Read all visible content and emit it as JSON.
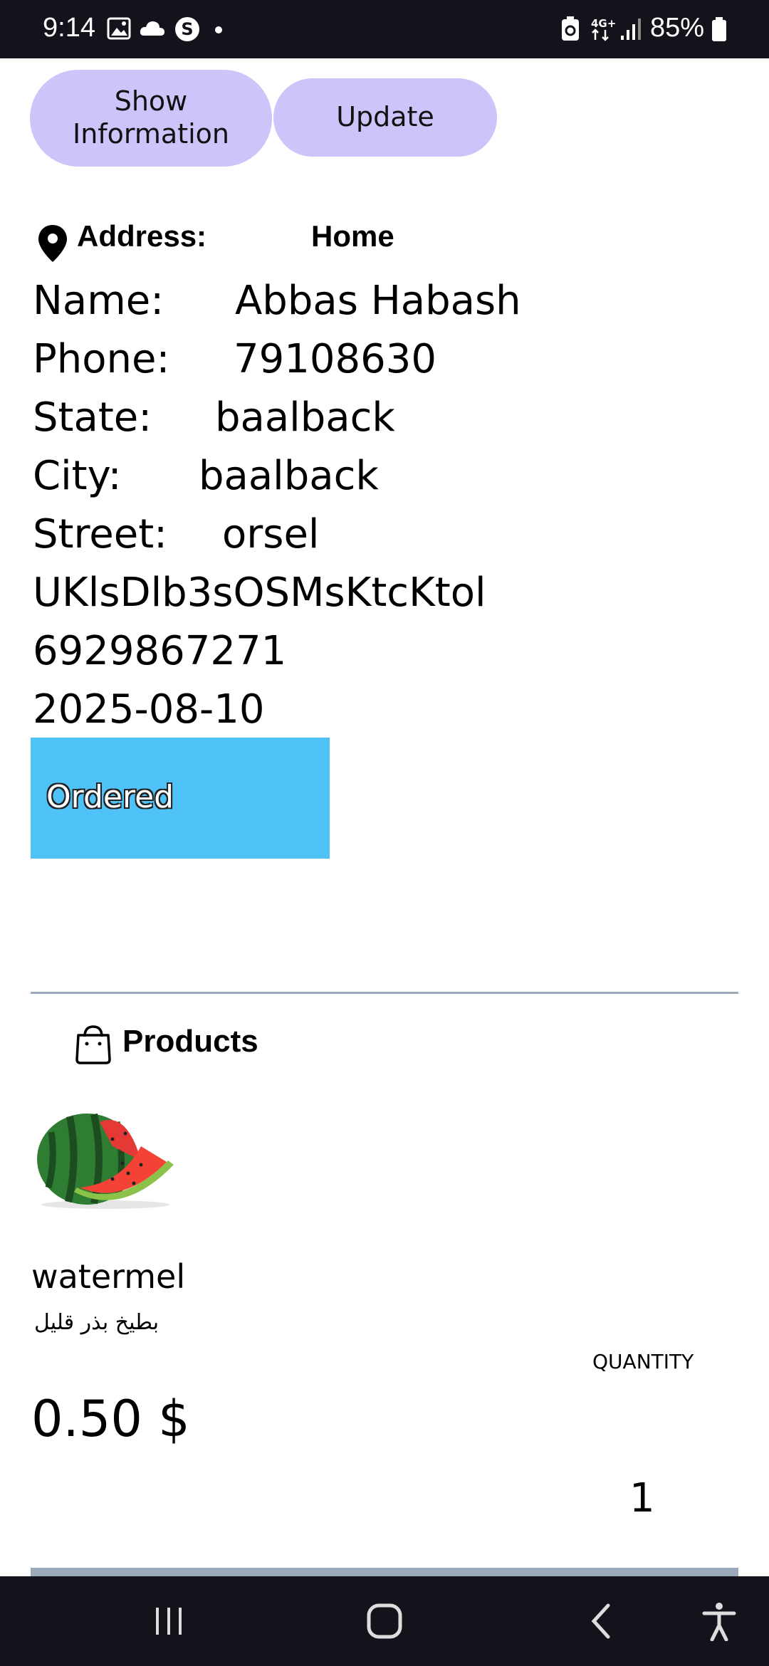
{
  "status_bar": {
    "time": "9:14",
    "battery": "85%",
    "icons": [
      "gallery-icon",
      "cloud-icon",
      "s-app-icon",
      "dot-icon",
      "battery-saver-icon",
      "4g-icon",
      "signal-icon",
      "battery-icon"
    ]
  },
  "buttons": {
    "show_information": "Show Information",
    "update": "Update"
  },
  "address": {
    "label": "Address:",
    "value": "Home",
    "icon": "location-pin-icon"
  },
  "info": {
    "name_label": "Name:",
    "name_value": "Abbas Habash",
    "phone_label": "Phone:",
    "phone_value": "79108630",
    "state_label": "State:",
    "state_value": "baalback",
    "city_label": "City:",
    "city_value": "baalback",
    "street_label": "Street:",
    "street_value": "orsel",
    "order_code": "UKlsDlb3sOSMsKtcKtol",
    "order_number": "6929867271",
    "date": "2025-08-10"
  },
  "order_status": {
    "label": "Ordered",
    "color": "#4fc3f7"
  },
  "products": {
    "title": "Products",
    "icon": "shopping-bag-icon",
    "items": [
      {
        "name": "watermel",
        "subtitle": "بطيخ بذر قليل",
        "quantity_label": "QUANTITY",
        "price": "0.50 $",
        "quantity": "1",
        "image": "watermelon-image"
      }
    ]
  },
  "colors": {
    "button_bg": "#cfc4fa",
    "status_bar_bg": "#14121a",
    "divider": "#9aaabb"
  }
}
